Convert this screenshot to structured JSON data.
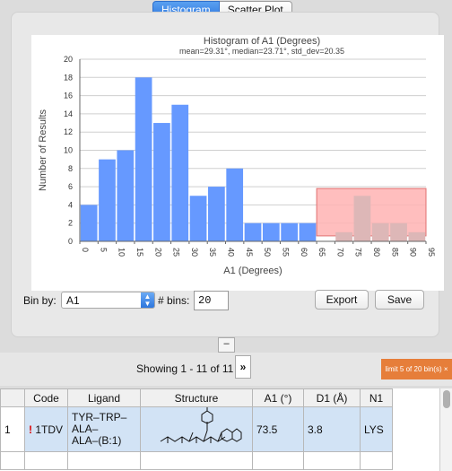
{
  "tabs": [
    {
      "label": "Histogram",
      "active": true
    },
    {
      "label": "Scatter Plot",
      "active": false
    }
  ],
  "chart_data": {
    "type": "bar",
    "title": "Histogram of A1 (Degrees)",
    "subtitle": "mean=29.31°, median=23.71°, std_dev=20.35",
    "xlabel": "A1 (Degrees)",
    "ylabel": "Number of Results",
    "xlim": [
      0,
      95
    ],
    "ylim": [
      0,
      20
    ],
    "x_ticks": [
      "0",
      "5",
      "10",
      "15",
      "20",
      "25",
      "30",
      "35",
      "40",
      "45",
      "50",
      "55",
      "60",
      "65",
      "70",
      "75",
      "80",
      "85",
      "90",
      "95"
    ],
    "y_ticks": [
      "0",
      "2",
      "4",
      "6",
      "8",
      "10",
      "12",
      "14",
      "16",
      "18",
      "20"
    ],
    "bin_width": 5,
    "bin_starts": [
      0,
      5,
      10,
      15,
      20,
      25,
      30,
      35,
      40,
      45,
      50,
      55,
      60,
      65,
      70,
      75,
      80,
      85,
      90
    ],
    "values": [
      4,
      9,
      10,
      18,
      13,
      15,
      5,
      6,
      8,
      2,
      2,
      2,
      2,
      0,
      1,
      5,
      2,
      2,
      1
    ],
    "bar_color": "#6699ff",
    "faded_bar_color": "#ddb7b7",
    "highlight_range": [
      65,
      95
    ],
    "highlight_ylim": [
      0.6,
      5.8
    ],
    "highlight_color": "#ffb3b3",
    "grid": "horizontal"
  },
  "controls": {
    "bin_by_label": "Bin by:",
    "bin_by_value": "A1",
    "bins_label": "# bins:",
    "bins_value": "20",
    "export_label": "Export",
    "save_label": "Save"
  },
  "collapse_label": "–",
  "pager": {
    "showing": "Showing 1 - 11 of 11",
    "next_label": "»",
    "limit_badge": "limit 5 of 20 bin(s)  ×"
  },
  "table": {
    "columns": [
      "Code",
      "Ligand",
      "Structure",
      "A1 (°)",
      "D1 (Å)",
      "N1"
    ],
    "rows": [
      {
        "num": "1",
        "flag": "!",
        "code": "1TDV",
        "ligand": [
          "TYR–TRP–",
          "ALA–",
          "ALA–(B:1)"
        ],
        "a1": "73.5",
        "d1": "3.8",
        "n1": "LYS"
      }
    ]
  }
}
